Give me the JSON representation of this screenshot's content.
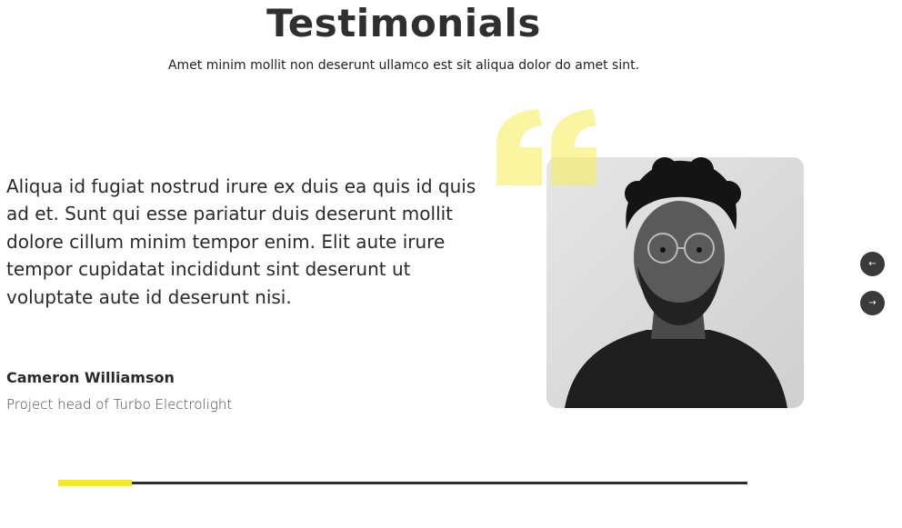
{
  "header": {
    "title": "Testimonials",
    "subtitle": "Amet minim mollit non deserunt ullamco est sit aliqua dolor do amet sint."
  },
  "testimonial": {
    "quote": "Aliqua id fugiat nostrud irure ex duis ea quis id quis ad et. Sunt qui esse pariatur duis deserunt mollit dolore cillum minim tempor enim. Elit aute irure tempor cupidatat incididunt sint deserunt ut voluptate aute id deserunt nisi.",
    "author_name": "Cameron Williamson",
    "author_role": "Project head of Turbo Electrolight",
    "photo_icon": "portrait-photo",
    "quote_icon": "quote-mark-icon"
  },
  "navigation": {
    "prev_label": "←",
    "next_label": "→"
  },
  "progress": {
    "fraction": 0.107
  },
  "colors": {
    "accent": "#f5ea1c",
    "quote_mark": "#f7ee55",
    "nav_button": "#3a3a3a",
    "text": "#2f2f2f"
  }
}
